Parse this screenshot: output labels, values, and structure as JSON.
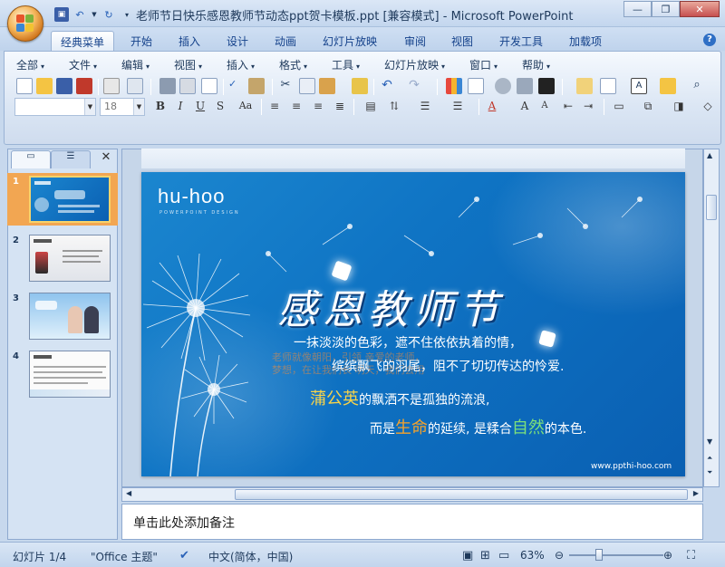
{
  "window": {
    "title": "老师节日快乐感恩教师节动态ppt贺卡模板.ppt [兼容模式] - Microsoft PowerPoint"
  },
  "ribbon_tabs": [
    "经典菜单",
    "开始",
    "插入",
    "设计",
    "动画",
    "幻灯片放映",
    "审阅",
    "视图",
    "开发工具",
    "加载项"
  ],
  "classic_menu": [
    "全部",
    "文件",
    "编辑",
    "视图",
    "插入",
    "格式",
    "工具",
    "幻灯片放映",
    "窗口",
    "帮助"
  ],
  "font_size": "18",
  "slides_count": 4,
  "slide": {
    "logo": "hu-hoo",
    "logo_sub": "POWERPOINT DESIGN",
    "title_chars": "感恩教师节",
    "lines": [
      "一抹淡淡的色彩，遮不住依依执着的情，",
      "缤缤飘飞的羽尾，阻不了切切传达的怜爱.",
      "蒲公英",
      "的飘洒不是孤独的流浪,",
      "而是",
      "生命",
      "的延续, 是糅合",
      "自然",
      "的本色."
    ],
    "ghost_text_1": "老师就像朝阳，引领 亲爱的老师，",
    "ghost_text_2": "梦想，在让我们长 明天，我们会用 ",
    "url": "www.ppthi-hoo.com"
  },
  "notes": {
    "placeholder": "单击此处添加备注"
  },
  "status": {
    "slide_pos": "幻灯片 1/4",
    "theme": "\"Office 主题\"",
    "language": "中文(简体，中国)",
    "zoom": "63%"
  },
  "colors": {
    "highlight_yellow": "#f7d34a",
    "highlight_green": "#7de07a",
    "highlight_orange": "#f4a22c"
  }
}
